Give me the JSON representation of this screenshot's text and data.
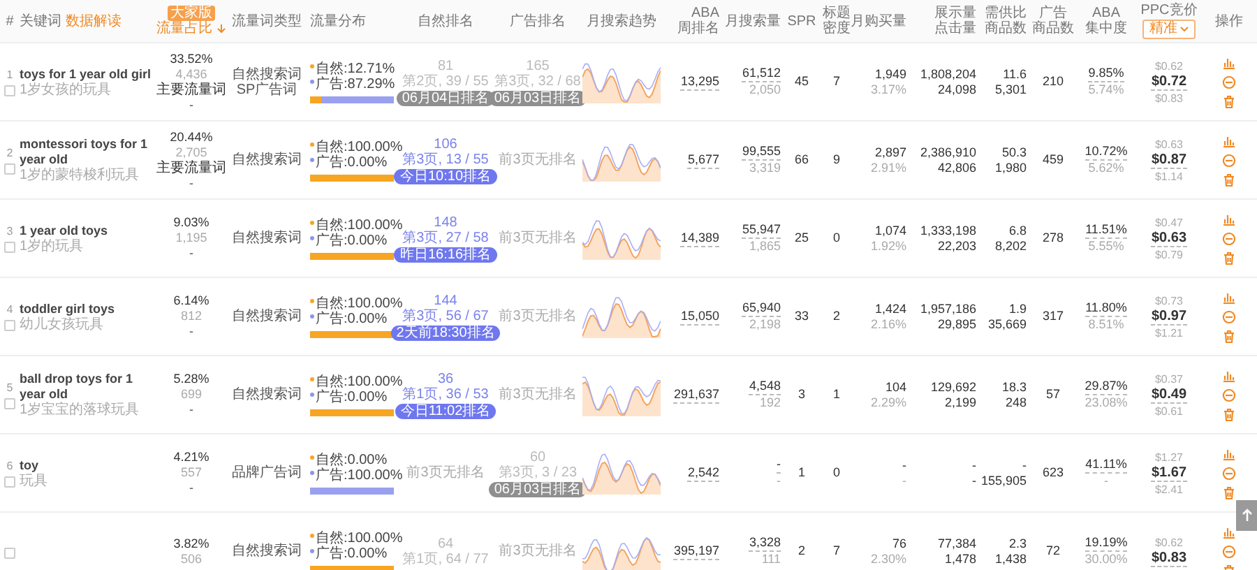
{
  "columns": [
    {
      "label": "#",
      "sorted": false
    },
    {
      "label": "关键词",
      "link": "数据解读",
      "sorted": false
    },
    {
      "label": "流量占比",
      "badge": "大家版",
      "sorted": true
    },
    {
      "label": "流量词类型",
      "sorted": false
    },
    {
      "label": "流量分布",
      "sorted": false
    },
    {
      "label": "自然排名",
      "sorted": false
    },
    {
      "label": "广告排名",
      "sorted": false
    },
    {
      "label": "月搜索趋势",
      "sorted": false
    },
    {
      "label": "ABA",
      "label_2": "周排名",
      "sorted": false
    },
    {
      "label": "月搜索量",
      "sorted": false
    },
    {
      "label": "SPR",
      "sorted": false
    },
    {
      "label": "标题",
      "label_2": "密度",
      "sorted": false
    },
    {
      "label": "月购买量",
      "sorted": false
    },
    {
      "label": "展示量",
      "label_2": "点击量",
      "sorted": false
    },
    {
      "label": "需供比",
      "label_2": "商品数",
      "sorted": false
    },
    {
      "label": "广告",
      "label_2": "商品数",
      "sorted": false
    },
    {
      "label": "ABA",
      "label_2": "集中度",
      "sorted": false
    },
    {
      "label": "PPC竞价",
      "dropdown": "精准",
      "sorted": false
    },
    {
      "label": "操作",
      "sorted": false
    }
  ],
  "rows": [
    {
      "index": "1",
      "checked": false,
      "keyword": "toys for 1 year old girl",
      "translation": "1岁女孩的玩具",
      "share": "33.52%",
      "share_count": "4,436",
      "tag": "主要流量词",
      "share_note": "-",
      "types": [
        "自然搜索词",
        "SP广告词"
      ],
      "natural_label": "自然:",
      "natural_pct": "12.71%",
      "ad_label": "广告:",
      "ad_pct": "87.29%",
      "level": 0.1271,
      "natural_rank": {
        "kind": "ranked",
        "value": "81",
        "position": "第2页, 39 / 55",
        "badge": "06月04日排名",
        "stale": true
      },
      "ad_rank": {
        "kind": "ranked",
        "value": "165",
        "position": "第3页, 32 / 68",
        "badge": "06月03日排名",
        "stale": true
      },
      "aba_rank": "13,295",
      "search": "61,512",
      "search_2": "2,050",
      "spr": "45",
      "density": "7",
      "buy": "1,949",
      "buy_rate": "3.17%",
      "impressions": "1,808,204",
      "clicks": "24,098",
      "ratio": "11.6",
      "products": "5,301",
      "ad_products": "210",
      "concentration": "9.85%",
      "concentration_2": "5.74%",
      "ppc_low": "$0.62",
      "ppc": "$0.72",
      "ppc_high": "$0.83"
    },
    {
      "index": "2",
      "checked": false,
      "keyword": "montessori toys for 1 year old",
      "translation": "1岁的蒙特梭利玩具",
      "share": "20.44%",
      "share_count": "2,705",
      "tag": "主要流量词",
      "share_note": "-",
      "types": [
        "自然搜索词"
      ],
      "natural_label": "自然:",
      "natural_pct": "100.00%",
      "ad_label": "广告:",
      "ad_pct": "0.00%",
      "level": 1,
      "natural_rank": {
        "kind": "ranked",
        "value": "106",
        "position": "第3页, 13 / 55",
        "badge": "今日10:10排名",
        "stale": false
      },
      "ad_rank": {
        "kind": "none",
        "text": "前3页无排名"
      },
      "aba_rank": "5,677",
      "search": "99,555",
      "search_2": "3,319",
      "spr": "66",
      "density": "9",
      "buy": "2,897",
      "buy_rate": "2.91%",
      "impressions": "2,386,910",
      "clicks": "42,806",
      "ratio": "50.3",
      "products": "1,980",
      "ad_products": "459",
      "concentration": "10.72%",
      "concentration_2": "5.62%",
      "ppc_low": "$0.63",
      "ppc": "$0.87",
      "ppc_high": "$1.14"
    },
    {
      "index": "3",
      "checked": false,
      "keyword": "1 year old toys",
      "translation": "1岁的玩具",
      "share": "9.03%",
      "share_count": "1,195",
      "share_note": "-",
      "types": [
        "自然搜索词"
      ],
      "natural_label": "自然:",
      "natural_pct": "100.00%",
      "ad_label": "广告:",
      "ad_pct": "0.00%",
      "level": 1,
      "natural_rank": {
        "kind": "ranked",
        "value": "148",
        "position": "第3页, 27 / 58",
        "badge": "昨日16:16排名",
        "stale": false
      },
      "ad_rank": {
        "kind": "none",
        "text": "前3页无排名"
      },
      "aba_rank": "14,389",
      "search": "55,947",
      "search_2": "1,865",
      "spr": "25",
      "density": "0",
      "buy": "1,074",
      "buy_rate": "1.92%",
      "impressions": "1,333,198",
      "clicks": "22,203",
      "ratio": "6.8",
      "products": "8,202",
      "ad_products": "278",
      "concentration": "11.51%",
      "concentration_2": "5.55%",
      "ppc_low": "$0.47",
      "ppc": "$0.63",
      "ppc_high": "$0.79"
    },
    {
      "index": "4",
      "checked": false,
      "keyword": "toddler girl toys",
      "translation": "幼儿女孩玩具",
      "share": "6.14%",
      "share_count": "812",
      "share_note": "-",
      "types": [
        "自然搜索词"
      ],
      "natural_label": "自然:",
      "natural_pct": "100.00%",
      "ad_label": "广告:",
      "ad_pct": "0.00%",
      "level": 1,
      "natural_rank": {
        "kind": "ranked",
        "value": "144",
        "position": "第3页, 56 / 67",
        "badge": "2天前18:30排名",
        "stale": false
      },
      "ad_rank": {
        "kind": "none",
        "text": "前3页无排名"
      },
      "aba_rank": "15,050",
      "search": "65,940",
      "search_2": "2,198",
      "spr": "33",
      "density": "2",
      "buy": "1,424",
      "buy_rate": "2.16%",
      "impressions": "1,957,186",
      "clicks": "29,895",
      "ratio": "1.9",
      "products": "35,669",
      "ad_products": "317",
      "concentration": "11.80%",
      "concentration_2": "8.51%",
      "ppc_low": "$0.73",
      "ppc": "$0.97",
      "ppc_high": "$1.21"
    },
    {
      "index": "5",
      "checked": false,
      "keyword": "ball drop toys for 1 year old",
      "translation": "1岁宝宝的落球玩具",
      "share": "5.28%",
      "share_count": "699",
      "share_note": "-",
      "types": [
        "自然搜索词"
      ],
      "natural_label": "自然:",
      "natural_pct": "100.00%",
      "ad_label": "广告:",
      "ad_pct": "0.00%",
      "level": 1,
      "natural_rank": {
        "kind": "ranked",
        "value": "36",
        "position": "第1页, 36 / 53",
        "badge": "今日11:02排名",
        "stale": false
      },
      "ad_rank": {
        "kind": "none",
        "text": "前3页无排名"
      },
      "aba_rank": "291,637",
      "search": "4,548",
      "search_2": "192",
      "spr": "3",
      "density": "1",
      "buy": "104",
      "buy_rate": "2.29%",
      "impressions": "129,692",
      "clicks": "2,199",
      "ratio": "18.3",
      "products": "248",
      "ad_products": "57",
      "concentration": "29.87%",
      "concentration_2": "23.08%",
      "ppc_low": "$0.37",
      "ppc": "$0.49",
      "ppc_high": "$0.61"
    },
    {
      "index": "6",
      "checked": false,
      "keyword": "toy",
      "translation": "玩具",
      "share": "4.21%",
      "share_count": "557",
      "share_note": "-",
      "types": [
        "品牌广告词"
      ],
      "natural_label": "自然:",
      "natural_pct": "0.00%",
      "ad_label": "广告:",
      "ad_pct": "100.00%",
      "level": 0,
      "natural_rank": {
        "kind": "none",
        "text": "前3页无排名"
      },
      "ad_rank": {
        "kind": "ranked",
        "value": "60",
        "position": "第3页, 3 / 23",
        "badge": "06月03日排名",
        "stale": true
      },
      "aba_rank": "2,542",
      "search": "-",
      "search_2": "-",
      "spr": "1",
      "density": "0",
      "buy": "-",
      "buy_rate": "-",
      "impressions": "-",
      "clicks": "-",
      "ratio": "-",
      "products": "155,905",
      "ad_products": "623",
      "concentration": "41.11%",
      "concentration_2": "-",
      "ppc_low": "$1.27",
      "ppc": "$1.67",
      "ppc_high": "$2.41"
    },
    {
      "checked": false,
      "share": "3.82%",
      "share_count": "506",
      "types": [
        "自然搜索词"
      ],
      "natural_label": "自然:",
      "natural_pct": "100.00%",
      "ad_label": "广告:",
      "ad_pct": "0.00%",
      "level": 1,
      "natural_rank": {
        "kind": "ranked",
        "value": "64",
        "position": "第1页, 64 / 77",
        "stale": true
      },
      "ad_rank": {
        "kind": "none",
        "text": "前3页无排名"
      },
      "aba_rank": "395,197",
      "search": "3,328",
      "search_2": "111",
      "spr": "2",
      "density": "7",
      "buy": "76",
      "buy_rate": "2.30%",
      "impressions": "77,384",
      "clicks": "1,478",
      "ratio": "2.3",
      "products": "1,438",
      "ad_products": "72",
      "concentration": "19.19%",
      "concentration_2": "30.00%",
      "ppc_low": "$0.62",
      "ppc": "$0.83"
    }
  ]
}
